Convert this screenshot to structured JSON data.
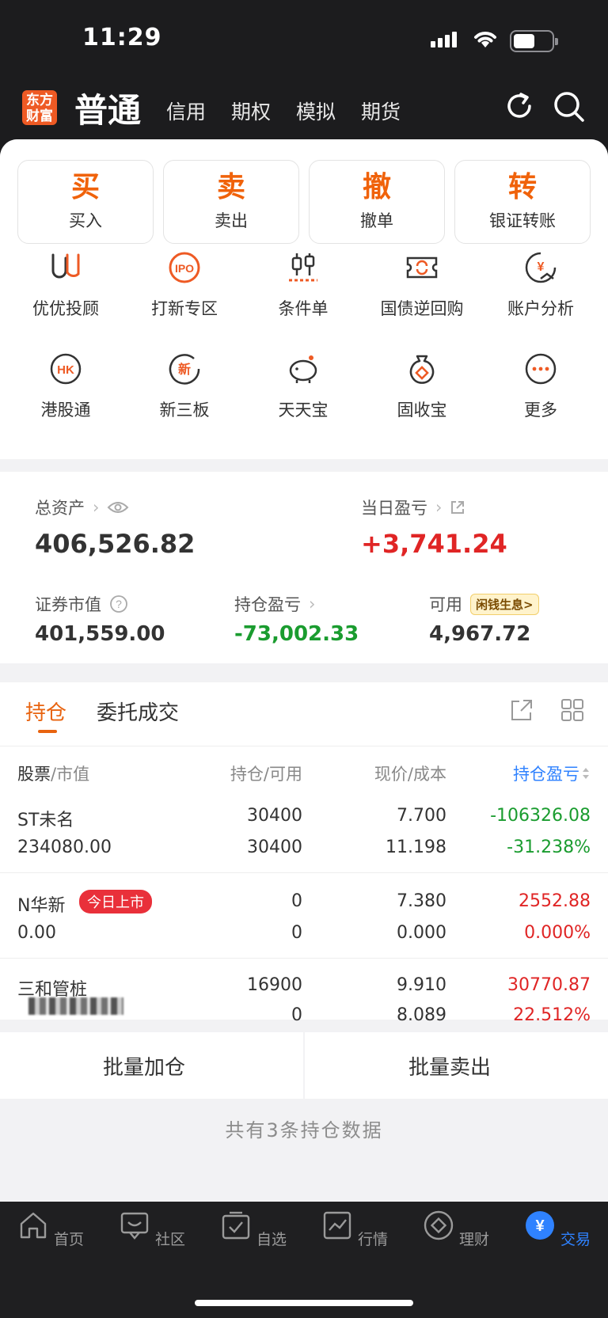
{
  "status": {
    "time": "11:29"
  },
  "header": {
    "logo": "东方财富",
    "logo_line1": "东方",
    "logo_line2": "财富",
    "account_type": "普通",
    "tabs": [
      "信用",
      "期权",
      "模拟",
      "期货"
    ]
  },
  "actions": [
    {
      "char": "买",
      "label": "买入"
    },
    {
      "char": "卖",
      "label": "卖出"
    },
    {
      "char": "撤",
      "label": "撤单"
    },
    {
      "char": "转",
      "label": "银证转账"
    }
  ],
  "features": [
    {
      "label": "优优投顾",
      "icon": "uu-advisor-icon"
    },
    {
      "label": "打新专区",
      "icon": "ipo-icon",
      "icon_text": "IPO"
    },
    {
      "label": "条件单",
      "icon": "candlestick-icon"
    },
    {
      "label": "国债逆回购",
      "icon": "repo-icon"
    },
    {
      "label": "账户分析",
      "icon": "yen-chart-icon",
      "icon_text": "¥"
    },
    {
      "label": "港股通",
      "icon": "hk-icon",
      "icon_text": "HK"
    },
    {
      "label": "新三板",
      "icon": "new-board-icon",
      "icon_text": "新"
    },
    {
      "label": "天天宝",
      "icon": "piggy-bank-icon"
    },
    {
      "label": "固收宝",
      "icon": "money-bag-icon"
    },
    {
      "label": "更多",
      "icon": "more-icon"
    }
  ],
  "assets": {
    "total_label": "总资产",
    "total_value": "406,526.82",
    "daily_label": "当日盈亏",
    "daily_value": "+3,741.24",
    "market_label": "证券市值",
    "market_value": "401,559.00",
    "position_pl_label": "持仓盈亏",
    "position_pl_value": "-73,002.33",
    "available_label": "可用",
    "available_value": "4,967.72",
    "promo_badge": "闲钱生息>"
  },
  "holdings_tabs": {
    "active": "持仓",
    "other": "委托成交"
  },
  "table": {
    "headers": {
      "stock": "股票",
      "market_value": "/市值",
      "position": "持仓/可用",
      "price": "现价/成本",
      "pl": "持仓盈亏"
    },
    "rows": [
      {
        "name": "ST未名",
        "value": "234080.00",
        "hold": "30400",
        "avail": "30400",
        "price": "7.700",
        "cost": "11.198",
        "pl": "-106326.08",
        "pl_pct": "-31.238%",
        "tone": "green"
      },
      {
        "name": "N华新",
        "badge": "今日上市",
        "value": "0.00",
        "hold": "0",
        "avail": "0",
        "price": "7.380",
        "cost": "0.000",
        "pl": "2552.88",
        "pl_pct": "0.000%",
        "tone": "red"
      },
      {
        "name": "三和管桩",
        "value": "",
        "hold": "16900",
        "avail": "0",
        "price": "9.910",
        "cost": "8.089",
        "pl": "30770.87",
        "pl_pct": "22.512%",
        "tone": "red"
      }
    ]
  },
  "batch": {
    "add": "批量加仓",
    "sell": "批量卖出"
  },
  "footer_note": "共有3条持仓数据",
  "tabbar": [
    {
      "label": "首页",
      "icon": "home-icon"
    },
    {
      "label": "社区",
      "icon": "community-icon"
    },
    {
      "label": "自选",
      "icon": "watchlist-icon"
    },
    {
      "label": "行情",
      "icon": "market-icon"
    },
    {
      "label": "理财",
      "icon": "wealth-icon"
    },
    {
      "label": "交易",
      "icon": "trade-icon",
      "icon_text": "¥",
      "active": true
    }
  ],
  "colors": {
    "accent": "#e8630f",
    "up": "#e02525",
    "down": "#1a9c2f",
    "tab_active": "#2f82ff"
  }
}
